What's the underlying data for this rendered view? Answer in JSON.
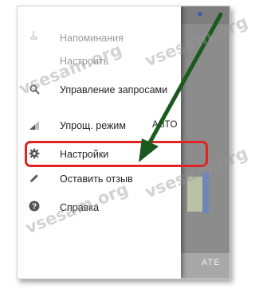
{
  "menu": {
    "items": [
      {
        "label": "Напоминания",
        "icon": "hand-icon",
        "faded": true,
        "trail": ""
      },
      {
        "label": "Настроить",
        "icon": "",
        "faded": true,
        "trail": ""
      },
      {
        "label": "Управление запросами",
        "icon": "search-icon",
        "faded": false,
        "trail": ""
      },
      {
        "label": "Упрощ. режим",
        "icon": "signal-icon",
        "faded": false,
        "trail": "АВТО"
      },
      {
        "label": "Настройки",
        "icon": "gear-icon",
        "faded": false,
        "trail": ""
      },
      {
        "label": "Оставить отзыв",
        "icon": "pencil-icon",
        "faded": false,
        "trail": ""
      },
      {
        "label": "Справка",
        "icon": "help-icon",
        "faded": false,
        "trail": ""
      }
    ]
  },
  "background": {
    "bottom_text": "ATE"
  },
  "watermark": "vsesam.org",
  "colors": {
    "highlight": "#e32222",
    "arrow": "#1a5a1f",
    "drawer": "#ffffff"
  }
}
